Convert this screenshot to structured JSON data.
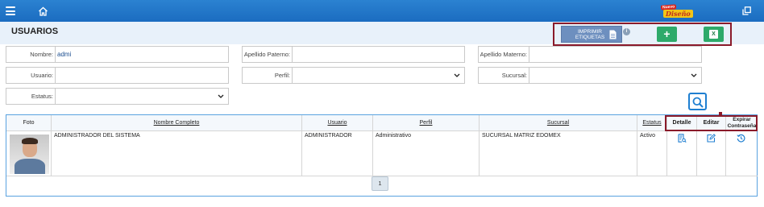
{
  "topbar": {
    "menu_icon": "hamburger-icon",
    "home_icon": "home-icon",
    "logo": {
      "top": "Nuevo",
      "bottom": "Diseño"
    },
    "window_icon": "restore-window-icon",
    "color": "#1f75c9"
  },
  "page": {
    "title": "USUARIOS"
  },
  "actions": {
    "print_label": "IMPRIMIR ETIQUETAS",
    "print_icon": "document-icon",
    "info_icon": "info-icon",
    "info_text": "i",
    "add_label": "+",
    "excel_label": "X",
    "excel_icon": "excel-icon",
    "accent": "#2eaa6a"
  },
  "filters": {
    "nombre": {
      "label": "Nombre:",
      "value": "admi"
    },
    "apellido_paterno": {
      "label": "Apellido Paterno:",
      "value": ""
    },
    "apellido_materno": {
      "label": "Apellido Materno:",
      "value": ""
    },
    "usuario": {
      "label": "Usuario:",
      "value": ""
    },
    "perfil": {
      "label": "Perfil:",
      "value": ""
    },
    "sucursal": {
      "label": "Sucursal:",
      "value": ""
    },
    "estatus": {
      "label": "Estatus:",
      "value": ""
    }
  },
  "search": {
    "icon": "search-icon"
  },
  "table": {
    "headers": {
      "foto": "Foto",
      "nombre": "Nombre Completo",
      "usuario": "Usuario",
      "perfil": "Perfil",
      "sucursal": "Sucursal",
      "estatus": "Estatus",
      "detalle": "Detalle",
      "editar": "Editar",
      "expirar": "Expirar Contraseña"
    },
    "rows": [
      {
        "nombre": "ADMINISTRADOR DEL SISTEMA",
        "usuario": "ADMINISTRADOR",
        "perfil": "Administrativo",
        "sucursal": "SUCURSAL MATRIZ EDOMEX",
        "estatus": "Activo",
        "detalle_icon": "detail-icon",
        "editar_icon": "edit-icon",
        "expirar_icon": "history-icon"
      }
    ]
  },
  "pagination": {
    "current": "1"
  }
}
